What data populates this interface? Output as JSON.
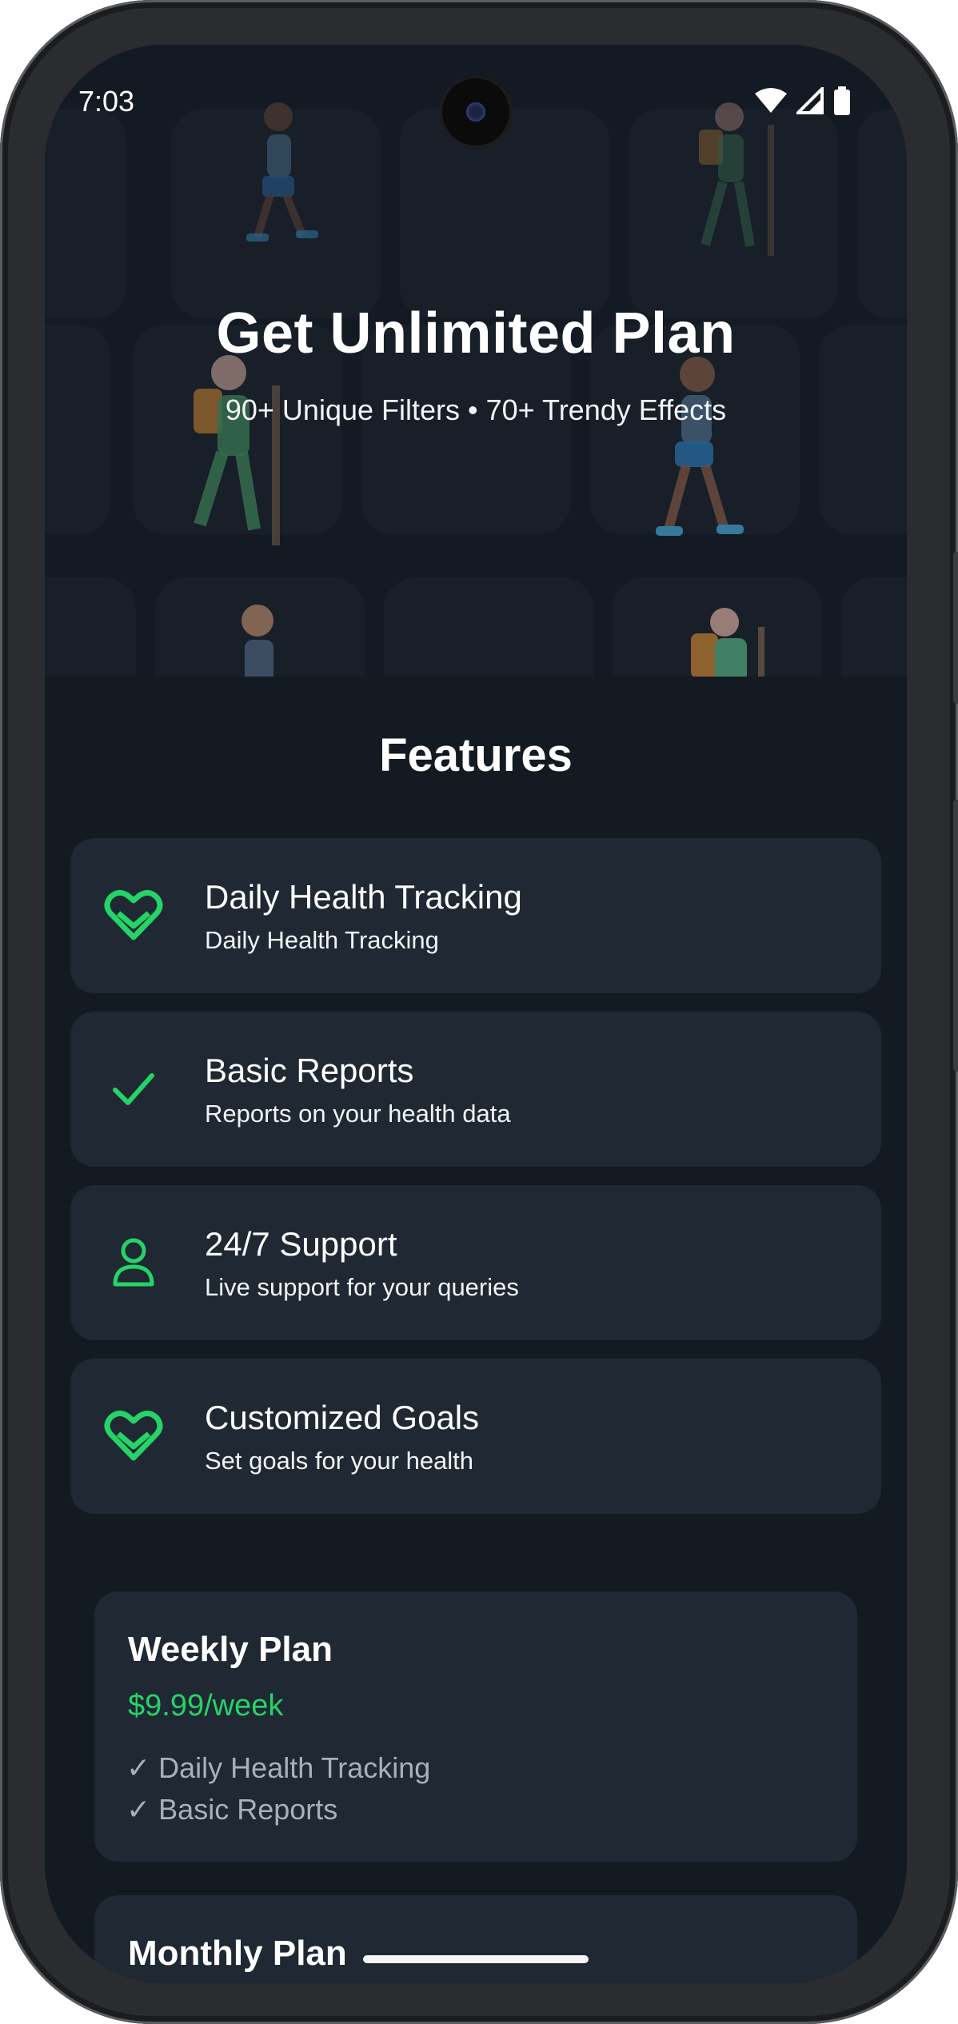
{
  "status_bar": {
    "time": "7:03"
  },
  "hero": {
    "title": "Get Unlimited Plan",
    "subtitle": "90+ Unique Filters • 70+ Trendy Effects"
  },
  "features": {
    "title": "Features",
    "items": [
      {
        "title": "Daily Health Tracking",
        "description": "Daily Health Tracking",
        "icon": "heart-pulse-icon"
      },
      {
        "title": "Basic Reports",
        "description": "Reports on your health data",
        "icon": "check-icon"
      },
      {
        "title": "24/7 Support",
        "description": "Live support for your queries",
        "icon": "person-icon"
      },
      {
        "title": "Customized Goals",
        "description": "Set goals for your health",
        "icon": "heart-pulse-icon"
      }
    ]
  },
  "plans": [
    {
      "name": "Weekly Plan",
      "price": "$9.99/week",
      "items": [
        "✓ Daily Health Tracking",
        "✓ Basic Reports"
      ]
    },
    {
      "name": "Monthly Plan"
    }
  ],
  "colors": {
    "accent": "#25d366",
    "background": "#131a22",
    "card": "#1f2833"
  }
}
